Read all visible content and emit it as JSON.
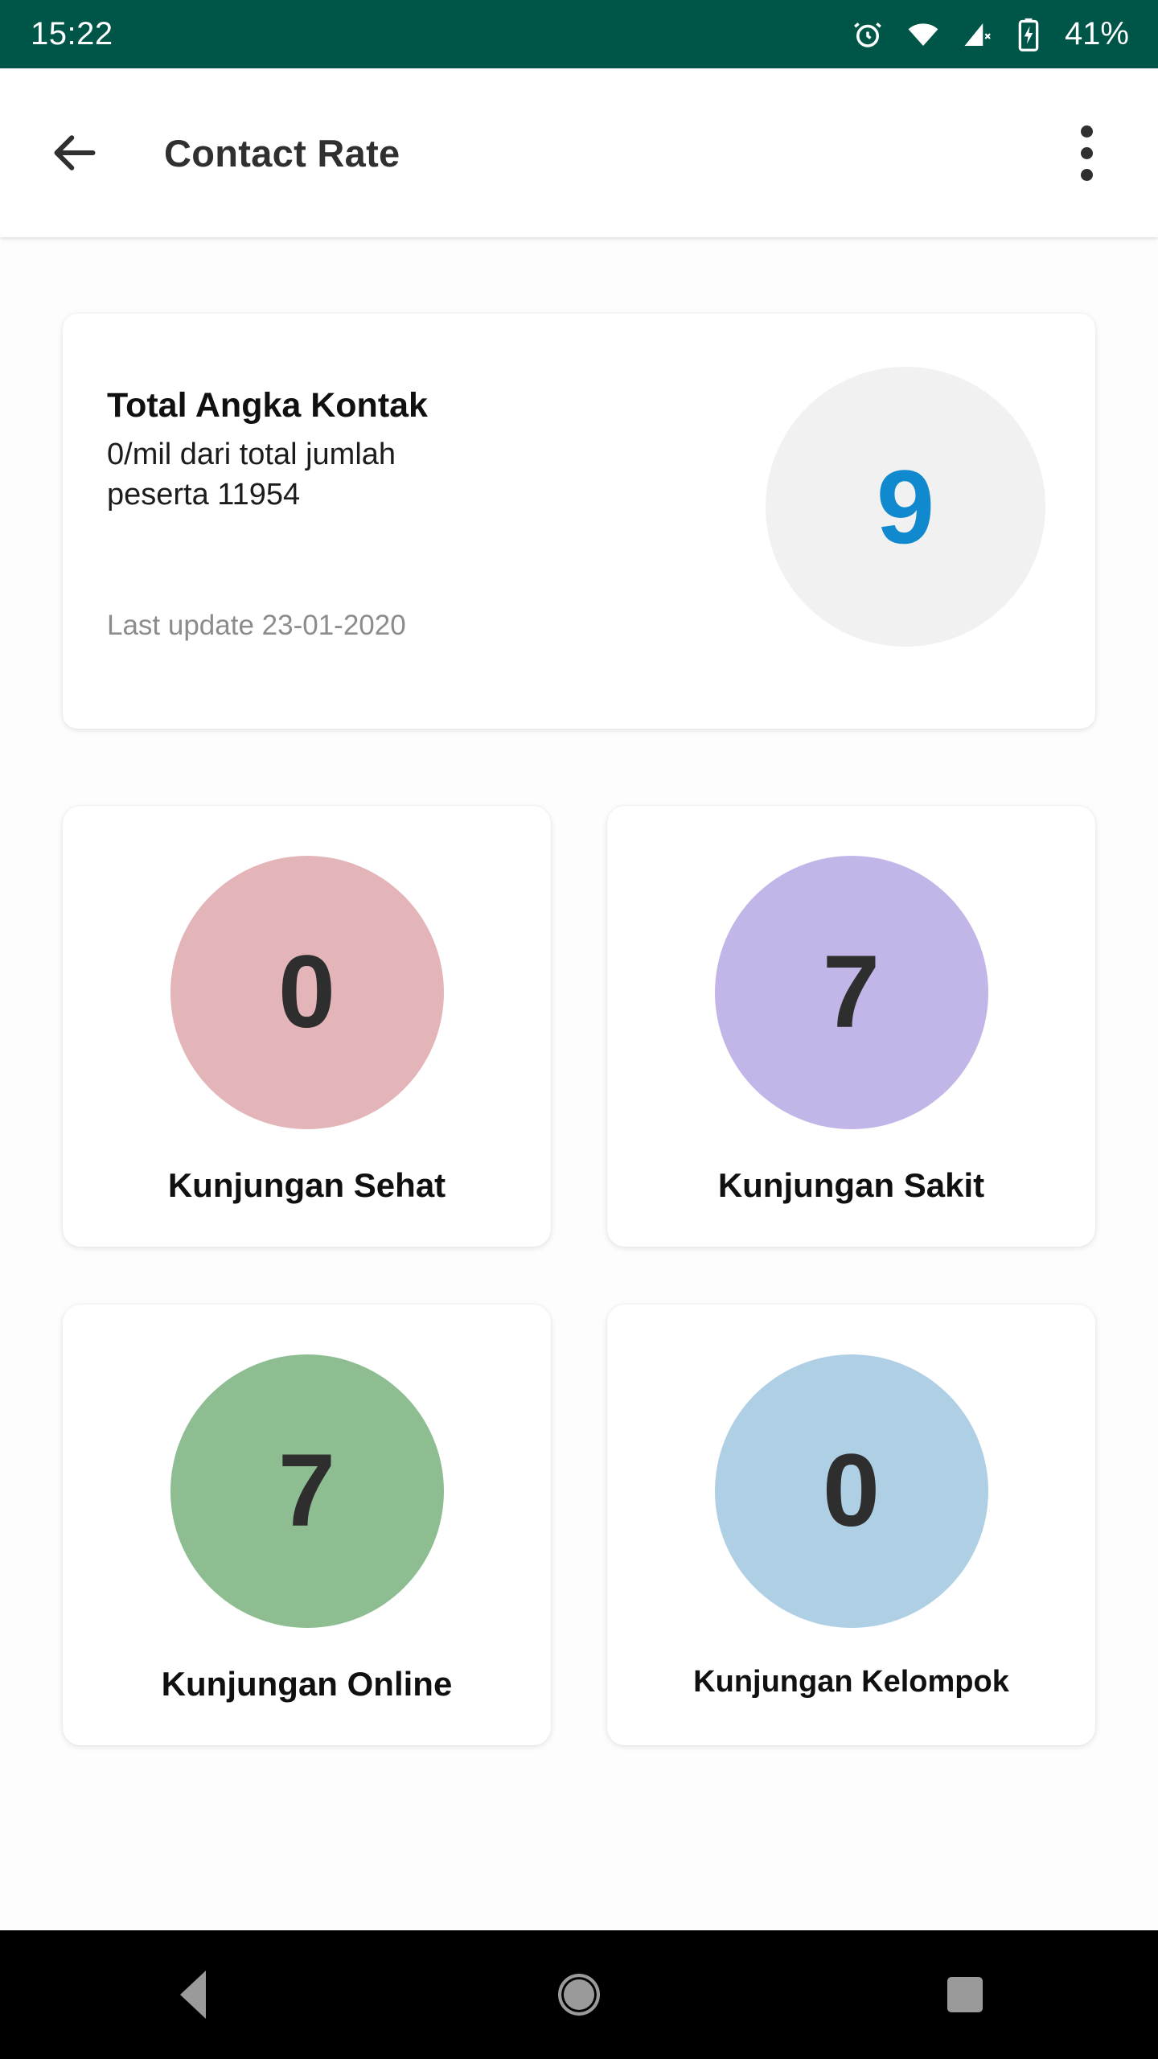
{
  "status_bar": {
    "time": "15:22",
    "battery_percent": "41%",
    "background_color": "#005549",
    "icons": [
      "alarm-icon",
      "wifi-icon",
      "cellular-signal-off-icon",
      "battery-charging-icon"
    ]
  },
  "app_bar": {
    "back_icon": "back-arrow-icon",
    "title": "Contact Rate",
    "overflow_icon": "more-vertical-icon"
  },
  "summary": {
    "title": "Total Angka Kontak",
    "subtitle": "0/mil dari total jumlah peserta 11954",
    "last_update": "Last update 23-01-2020",
    "value": "9",
    "value_color": "#1189ce",
    "circle_color": "#f1f1f1"
  },
  "metrics": [
    {
      "value": "0",
      "label": "Kunjungan Sehat",
      "color": "#e3b5b8"
    },
    {
      "value": "7",
      "label": "Kunjungan Sakit",
      "color": "#c2b6e8"
    },
    {
      "value": "7",
      "label": "Kunjungan Online",
      "color": "#8dbd90"
    },
    {
      "value": "0",
      "label": "Kunjungan Kelompok",
      "color": "#afcfe5"
    }
  ],
  "nav_bar": {
    "back_label": "back-triangle-icon",
    "home_label": "home-circle-icon",
    "recent_label": "recent-apps-square-icon",
    "background_color": "#000000"
  }
}
